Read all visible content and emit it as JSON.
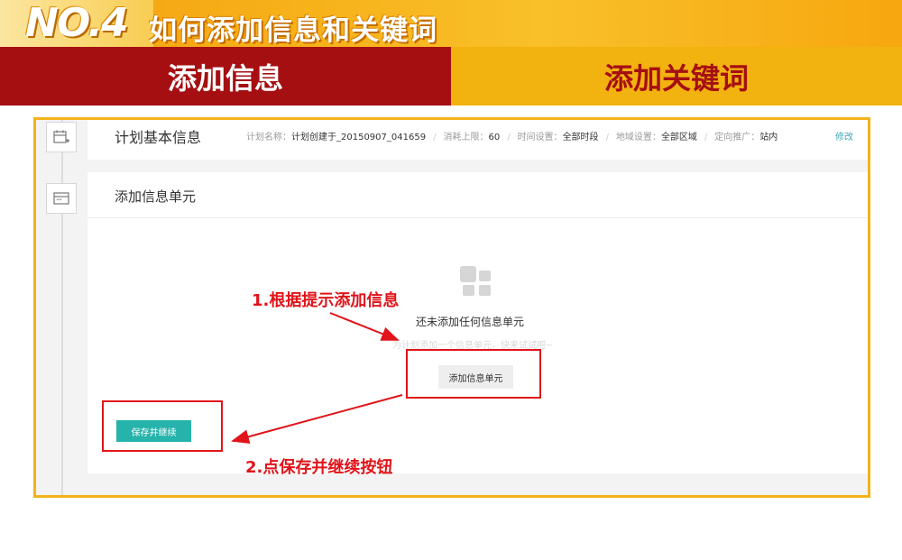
{
  "banner": {
    "badge": "NO.4",
    "title": "如何添加信息和关键词"
  },
  "tabs": [
    {
      "label": "添加信息",
      "active": true
    },
    {
      "label": "添加关键词",
      "active": false
    }
  ],
  "plan": {
    "title": "计划基本信息",
    "meta": [
      {
        "label": "计划名称：",
        "value": "计划创建于_20150907_041659"
      },
      {
        "label": "消耗上限：",
        "value": "60"
      },
      {
        "label": "时间设置：",
        "value": "全部时段"
      },
      {
        "label": "地域设置：",
        "value": "全部区域"
      },
      {
        "label": "定向推广：",
        "value": "站内"
      }
    ],
    "edit_label": "修改"
  },
  "info_unit": {
    "title": "添加信息单元",
    "empty_title": "还未添加任何信息单元",
    "empty_hint": "为计划添加一个信息单元，快来试试吧~",
    "add_button": "添加信息单元",
    "save_button": "保存并继续"
  },
  "annotations": {
    "step1": "1.根据提示添加信息",
    "step2": "2.点保存并继续按钮"
  },
  "colors": {
    "banner": "#f7b21a",
    "tab_active": "#a50f12",
    "tab_inactive": "#f2b20f",
    "frame": "#f2b31a",
    "save_button": "#26b3ac",
    "annotation": "#e0141a",
    "link": "#3fa7b6"
  }
}
